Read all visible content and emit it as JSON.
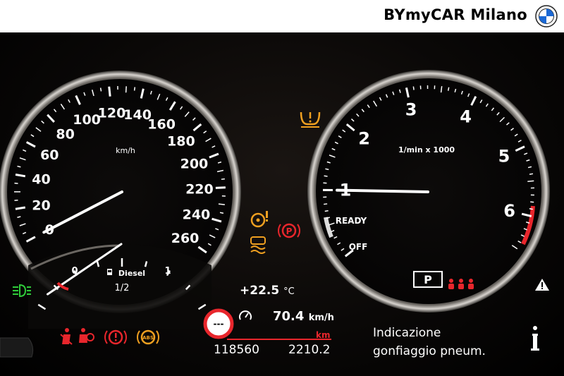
{
  "header": {
    "dealer_name": "BYmyCAR Milano",
    "logo_icon": "bmw-roundel-icon"
  },
  "speedometer": {
    "unit": "km/h",
    "ticks": [
      "0",
      "20",
      "40",
      "60",
      "80",
      "100",
      "120",
      "140",
      "160",
      "180",
      "200",
      "220",
      "240",
      "260"
    ],
    "needle_speed": 0
  },
  "fuel_gauge": {
    "label": "Diesel",
    "scale": [
      "0",
      "1/2",
      "1"
    ],
    "level": 0.07
  },
  "tachometer": {
    "unit": "1/min x 1000",
    "ticks": [
      "1",
      "2",
      "3",
      "4",
      "5",
      "6"
    ],
    "ready_label": "READY",
    "off_label": "OFF",
    "needle_rpm": 1.0
  },
  "status": {
    "gear": "P",
    "temperature": "+22.5",
    "temperature_unit": "°C",
    "speed_value": "70.4",
    "speed_unit": "km/h",
    "odometer": "118560",
    "trip": "2210.2",
    "trip_unit": "km",
    "speed_limit": "---"
  },
  "message": {
    "line1": "Indicazione",
    "line2": "gonfiaggio pneum."
  },
  "colors": {
    "amber": "#f0a020",
    "red": "#e8262c",
    "green": "#2fcc3a",
    "white": "#ffffff"
  }
}
